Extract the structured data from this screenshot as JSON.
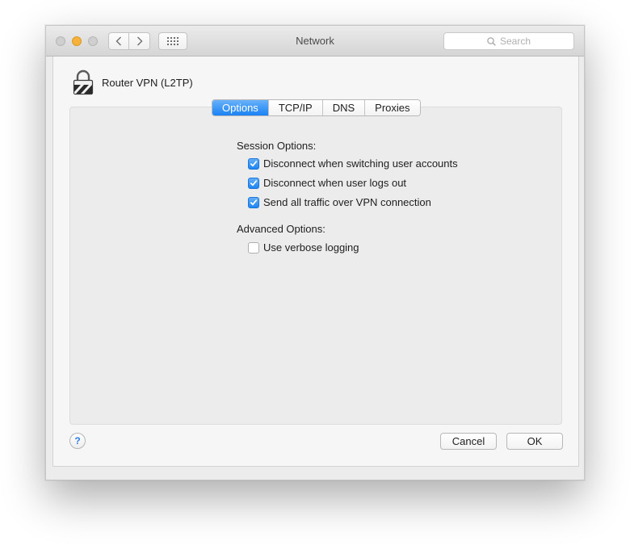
{
  "window": {
    "title": "Network",
    "search_placeholder": "Search"
  },
  "header": {
    "connection_name": "Router VPN (L2TP)",
    "icon": "lock-icon"
  },
  "tabs": [
    {
      "label": "Options",
      "active": true
    },
    {
      "label": "TCP/IP",
      "active": false
    },
    {
      "label": "DNS",
      "active": false
    },
    {
      "label": "Proxies",
      "active": false
    }
  ],
  "session_options": {
    "label": "Session Options:",
    "items": [
      {
        "label": "Disconnect when switching user accounts",
        "checked": true
      },
      {
        "label": "Disconnect when user logs out",
        "checked": true
      },
      {
        "label": "Send all traffic over VPN connection",
        "checked": true
      }
    ]
  },
  "advanced_options": {
    "label": "Advanced Options:",
    "items": [
      {
        "label": "Use verbose logging",
        "checked": false
      }
    ]
  },
  "footer": {
    "help_label": "?",
    "cancel_label": "Cancel",
    "ok_label": "OK"
  },
  "colors": {
    "accent": "#1b82f4",
    "minimize": "#f6b23a"
  }
}
